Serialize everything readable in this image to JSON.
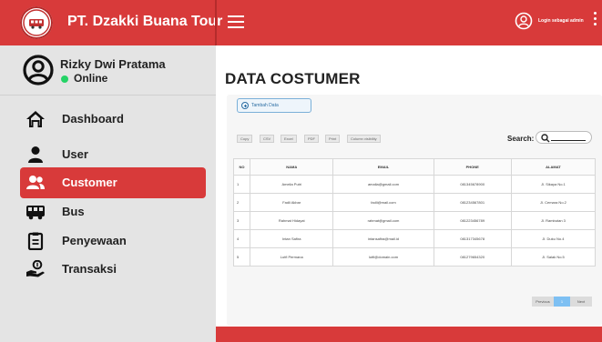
{
  "header": {
    "brand": "PT. Dzakki Buana Tour",
    "login_label": "Login sebagai admin"
  },
  "profile": {
    "name": "Rizky Dwi Pratama",
    "status": "Online",
    "status_color": "#25d366"
  },
  "nav": [
    {
      "label": "Dashboard",
      "icon": "home-icon",
      "active": false
    },
    {
      "label": "User",
      "icon": "user-icon",
      "active": false
    },
    {
      "label": "Customer",
      "icon": "users-icon",
      "active": true
    },
    {
      "label": "Bus",
      "icon": "bus-icon",
      "active": false
    },
    {
      "label": "Penyewaan",
      "icon": "clipboard-icon",
      "active": false
    },
    {
      "label": "Transaksi",
      "icon": "hand-money-icon",
      "active": false
    }
  ],
  "page": {
    "title": "DATA COSTUMER",
    "add_button": "Tambah Data",
    "export_buttons": [
      "Copy",
      "CSV",
      "Excel",
      "PDF",
      "Print",
      "Column visibility"
    ],
    "search_label": "Search:"
  },
  "table": {
    "headers": [
      "NO",
      "NAMA",
      "EMAIL",
      "PHONE",
      "ALAMAT"
    ],
    "rows": [
      [
        "1",
        "Amelia Putri",
        "amalia@gmail.com",
        "081345678900",
        "Jl. Sikaya No.1"
      ],
      [
        "2",
        "Fadli Akbar",
        "fadli@mail.com",
        "081234567801",
        "Jl. Cemara No.2"
      ],
      [
        "3",
        "Rahmat Hidayat",
        "rahmat@gmail.com",
        "081223456789",
        "Jl. Rambutan 3"
      ],
      [
        "4",
        "Intan Safira",
        "intansafira@mail.id",
        "081317345678",
        "Jl. Duku No.4"
      ],
      [
        "5",
        "Lutfi Permana",
        "lutfi@domain.com",
        "081279654320",
        "Jl. Salak No.5"
      ]
    ]
  },
  "pagination": {
    "prev": "Previous",
    "current": "1",
    "next": "Next"
  },
  "colors": {
    "accent": "#d83a3a",
    "sidebar": "#e4e4e4",
    "pager_active": "#7ec0f3"
  }
}
